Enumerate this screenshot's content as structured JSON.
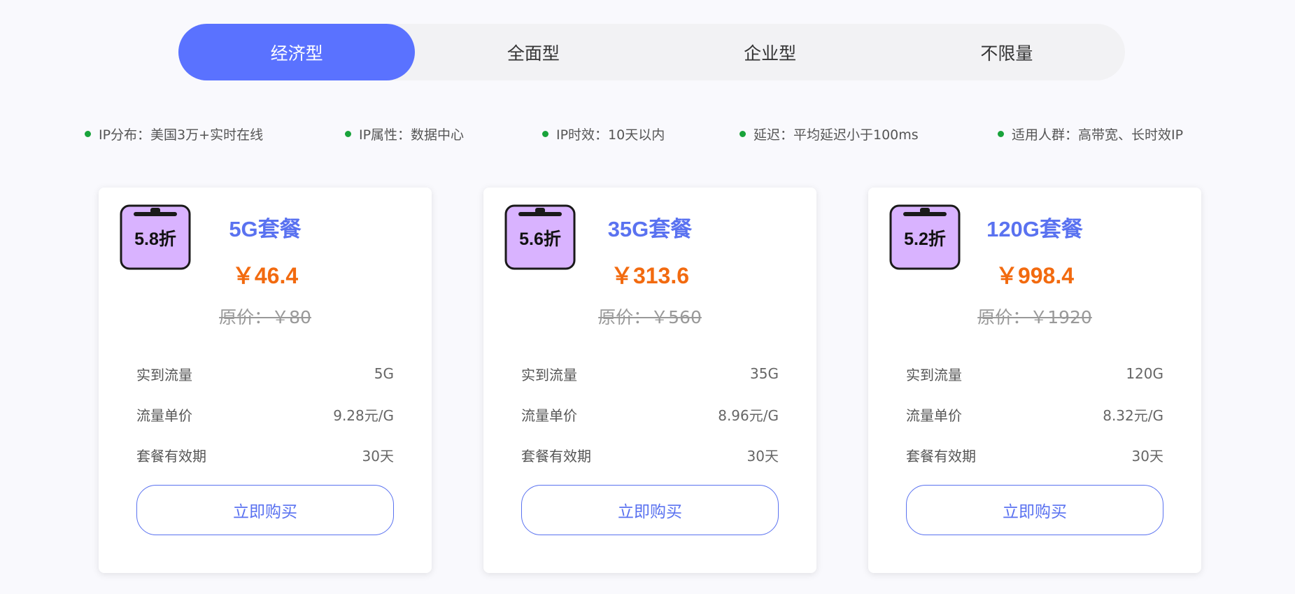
{
  "tabs": [
    {
      "label": "经济型",
      "active": true
    },
    {
      "label": "全面型",
      "active": false
    },
    {
      "label": "企业型",
      "active": false
    },
    {
      "label": "不限量",
      "active": false
    }
  ],
  "features": [
    "IP分布：美国3万+实时在线",
    "IP属性：数据中心",
    "IP时效：10天以内",
    "延迟：平均延迟小于100ms",
    "适用人群：高带宽、长时效IP"
  ],
  "colors": {
    "accent": "#5a72ff",
    "price": "#f26a0f",
    "dot": "#19a33b",
    "badge_fill": "#d9b3ff"
  },
  "cards": [
    {
      "discount": "5.8折",
      "name": "5G套餐",
      "price": "￥46.4",
      "original": "原价：￥80",
      "rows": [
        {
          "label": "实到流量",
          "value": "5G"
        },
        {
          "label": "流量单价",
          "value": "9.28元/G"
        },
        {
          "label": "套餐有效期",
          "value": "30天"
        }
      ],
      "buy_label": "立即购买"
    },
    {
      "discount": "5.6折",
      "name": "35G套餐",
      "price": "￥313.6",
      "original": "原价：￥560",
      "rows": [
        {
          "label": "实到流量",
          "value": "35G"
        },
        {
          "label": "流量单价",
          "value": "8.96元/G"
        },
        {
          "label": "套餐有效期",
          "value": "30天"
        }
      ],
      "buy_label": "立即购买"
    },
    {
      "discount": "5.2折",
      "name": "120G套餐",
      "price": "￥998.4",
      "original": "原价：￥1920",
      "rows": [
        {
          "label": "实到流量",
          "value": "120G"
        },
        {
          "label": "流量单价",
          "value": "8.32元/G"
        },
        {
          "label": "套餐有效期",
          "value": "30天"
        }
      ],
      "buy_label": "立即购买"
    }
  ]
}
